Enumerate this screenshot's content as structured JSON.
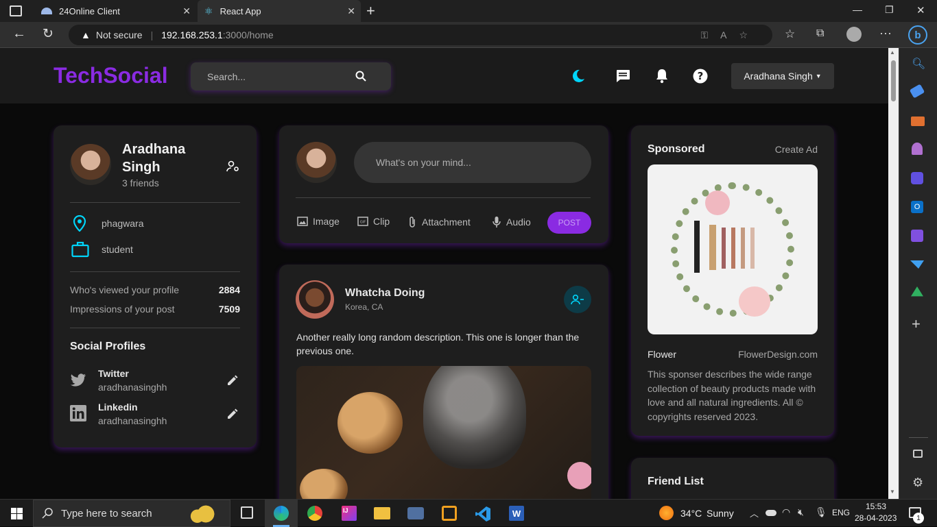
{
  "browser": {
    "tabs": [
      {
        "title": "24Online Client"
      },
      {
        "title": "React App"
      }
    ],
    "security_label": "Not secure",
    "url_host": "192.168.253.1",
    "url_path": ":3000/home"
  },
  "navbar": {
    "logo": "TechSocial",
    "search_placeholder": "Search...",
    "user_name": "Aradhana Singh"
  },
  "profile": {
    "name_line1": "Aradhana",
    "name_line2": "Singh",
    "friends": "3 friends",
    "location": "phagwara",
    "occupation": "student",
    "stats": [
      {
        "label": "Who's viewed your profile",
        "value": "2884"
      },
      {
        "label": "Impressions of your post",
        "value": "7509"
      }
    ],
    "social_title": "Social Profiles",
    "socials": [
      {
        "network": "Twitter",
        "handle": "aradhanasinghh"
      },
      {
        "network": "Linkedin",
        "handle": "aradhanasinghh"
      }
    ]
  },
  "composer": {
    "placeholder": "What's on your mind...",
    "actions": [
      {
        "label": "Image"
      },
      {
        "label": "Clip"
      },
      {
        "label": "Attachment"
      },
      {
        "label": "Audio"
      }
    ],
    "post_label": "POST"
  },
  "post": {
    "author": "Whatcha Doing",
    "location": "Korea, CA",
    "description": "Another really long random description. This one is longer than the previous one."
  },
  "sponsored": {
    "title": "Sponsored",
    "create_ad": "Create Ad",
    "name": "Flower",
    "site": "FlowerDesign.com",
    "description": "This sponser describes the wide range collection of beauty products made with love and all natural ingredients. All © copyrights reserved 2023."
  },
  "friends": {
    "title": "Friend List"
  },
  "taskbar": {
    "search_placeholder": "Type here to search",
    "weather_temp": "34°C",
    "weather_text": "Sunny",
    "language": "ENG",
    "time": "15:53",
    "date": "28-04-2023",
    "notification_count": "1"
  },
  "colors": {
    "accent": "#8a2be2",
    "cyan": "#00d5fa"
  }
}
